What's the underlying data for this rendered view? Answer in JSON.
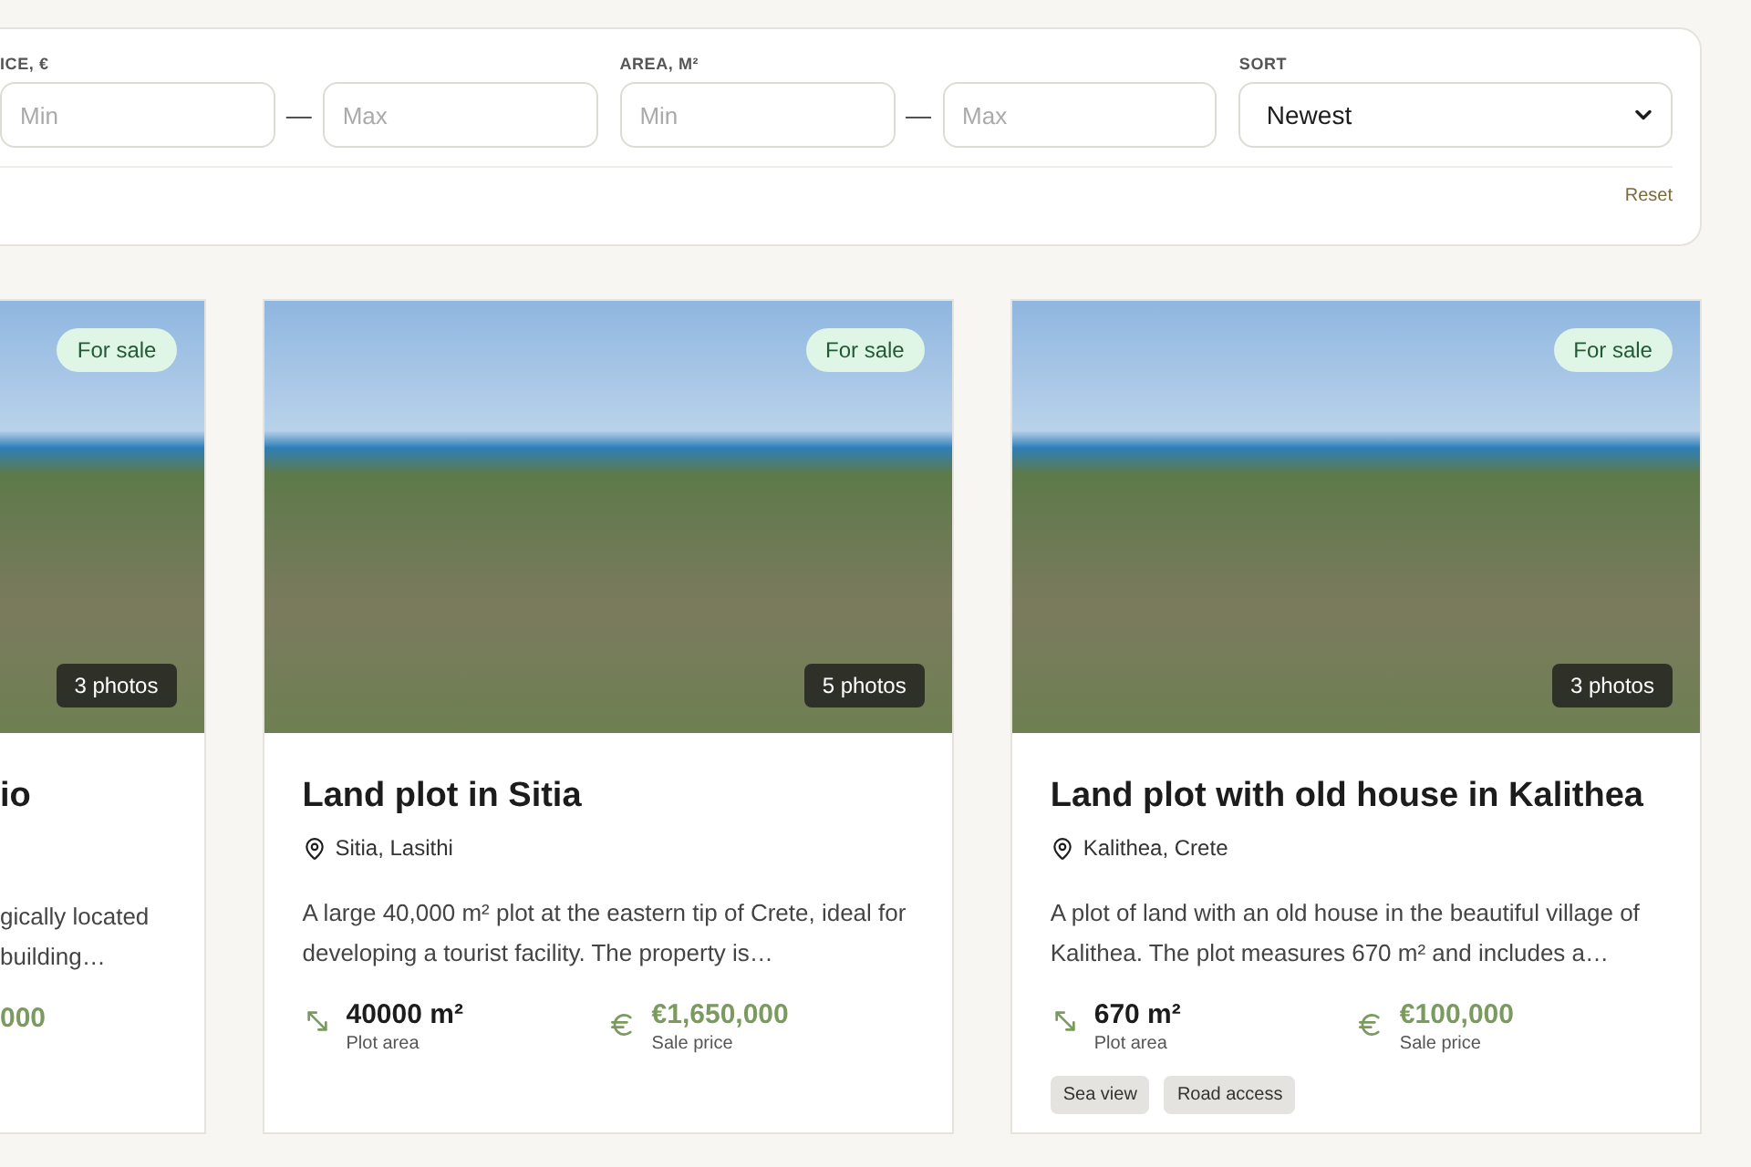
{
  "filters": {
    "ranges": [
      {
        "label": "ICE, €",
        "separator": "—",
        "min": {
          "placeholder": "Min"
        },
        "max": {
          "placeholder": "Max"
        }
      },
      {
        "label": "AREA, M²",
        "separator": "—",
        "min": {
          "placeholder": "Min"
        },
        "max": {
          "placeholder": "Max"
        }
      }
    ],
    "sort": {
      "label": "SORT",
      "value": "Newest"
    },
    "reset": "Reset"
  },
  "listings": [
    {
      "kind": "partial",
      "status": "For sale",
      "photos": "3 photos",
      "title": "io",
      "description": "gically located building…",
      "price": "000"
    },
    {
      "kind": "full",
      "status": "For sale",
      "photos": "5 photos",
      "title": "Land plot in Sitia",
      "location": "Sitia, Lasithi",
      "description": "A large 40,000 m² plot at the eastern tip of Crete, ideal for developing a tourist facility. The property is…",
      "area": "40000 m²",
      "area_label": "Plot area",
      "price": "€1,650,000",
      "price_label": "Sale price"
    },
    {
      "kind": "full",
      "status": "For sale",
      "photos": "3 photos",
      "title": "Land plot with old house in Kalithea",
      "location": "Kalithea, Crete",
      "description": "A plot of land with an old house in the beautiful village of Kalithea. The plot measures 670 m² and includes a…",
      "area": "670 m²",
      "area_label": "Plot area",
      "price": "€100,000",
      "price_label": "Sale price",
      "tags": [
        "Sea view",
        "Road access"
      ]
    }
  ]
}
